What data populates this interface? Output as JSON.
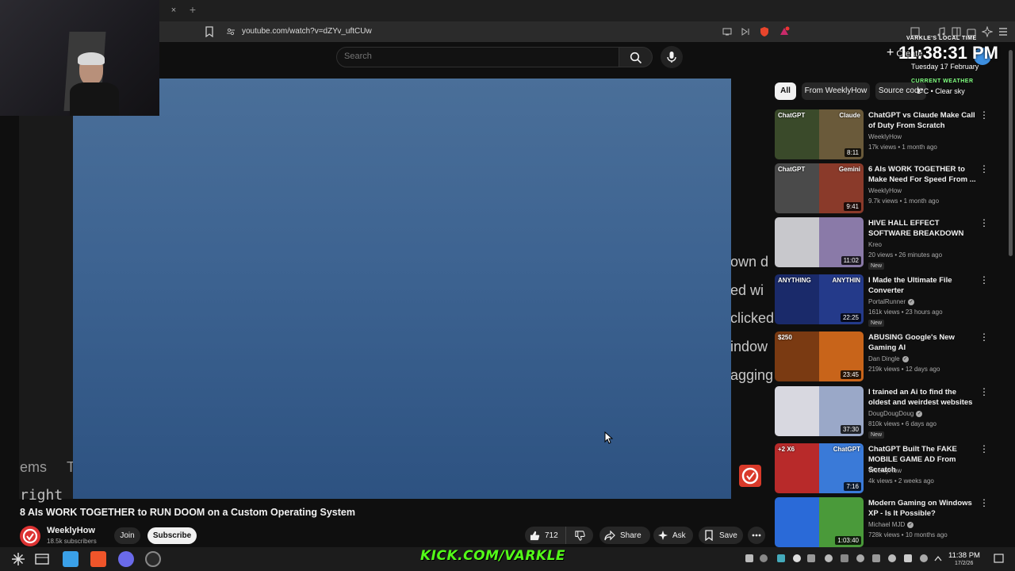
{
  "browser": {
    "url": "youtube.com/watch?v=dZYv_uftCUw",
    "tab_close": "×",
    "tab_new": "+"
  },
  "header": {
    "search_placeholder": "Search",
    "create_label": "Create"
  },
  "player": {
    "side_text": [
      "own d",
      "ed wi",
      "clicked",
      "indow",
      "agging",
      "ems",
      "T",
      "right"
    ]
  },
  "video": {
    "title": "8 AIs WORK TOGETHER to RUN DOOM on a Custom Operating System",
    "channel": "WeeklyHow",
    "subscribers": "18.5k subscribers",
    "join_label": "Join",
    "subscribe_label": "Subscribe",
    "likes": "712",
    "share_label": "Share",
    "ask_label": "Ask",
    "save_label": "Save"
  },
  "sidebar": {
    "chips": [
      "All",
      "From WeeklyHow",
      "Source code"
    ],
    "items": [
      {
        "title": "ChatGPT vs Claude Make Call of Duty From Scratch",
        "channel": "WeeklyHow",
        "verified": false,
        "meta": "17k views • 1 month ago",
        "duration": "8:11",
        "new": false,
        "thumb_colors": [
          "#3a4a2a",
          "#6a5a3a"
        ],
        "thumb_labels": [
          "ChatGPT",
          "Claude"
        ]
      },
      {
        "title": "6 AIs WORK TOGETHER to Make Need For Speed From ...",
        "channel": "WeeklyHow",
        "verified": false,
        "meta": "9.7k views • 1 month ago",
        "duration": "9:41",
        "new": false,
        "thumb_colors": [
          "#4a4a4a",
          "#8a3a2a"
        ],
        "thumb_labels": [
          "ChatGPT",
          "Gemini"
        ]
      },
      {
        "title": "HIVE HALL EFFECT SOFTWARE BREAKDOWN",
        "channel": "Kreo",
        "verified": false,
        "meta": "20 views • 26 minutes ago",
        "duration": "11:02",
        "new": true,
        "thumb_colors": [
          "#c8c8cc",
          "#8a7aa8"
        ],
        "thumb_labels": [
          "",
          ""
        ]
      },
      {
        "title": "I Made the Ultimate File Converter",
        "channel": "PortalRunner",
        "verified": true,
        "meta": "161k views • 23 hours ago",
        "duration": "22:25",
        "new": true,
        "thumb_colors": [
          "#1a2a6a",
          "#243a8a"
        ],
        "thumb_labels": [
          "ANYTHING",
          "ANYTHIN"
        ]
      },
      {
        "title": "ABUSING Google's New Gaming AI",
        "channel": "Dan Dingle",
        "verified": true,
        "meta": "219k views • 12 days ago",
        "duration": "23:45",
        "new": false,
        "thumb_colors": [
          "#7a3a12",
          "#c8641a"
        ],
        "thumb_labels": [
          "$250",
          ""
        ]
      },
      {
        "title": "I trained an Ai to find the oldest and weirdest websites",
        "channel": "DougDougDoug",
        "verified": true,
        "meta": "810k views • 6 days ago",
        "duration": "37:30",
        "new": true,
        "thumb_colors": [
          "#d8d8e0",
          "#9aa8c8"
        ],
        "thumb_labels": [
          "",
          ""
        ]
      },
      {
        "title": "ChatGPT Built The FAKE MOBILE GAME AD From Scratch",
        "channel": "WeeklyHow",
        "verified": false,
        "meta": "4k views • 2 weeks ago",
        "duration": "7:16",
        "new": false,
        "thumb_colors": [
          "#b82a2a",
          "#3a7ad8"
        ],
        "thumb_labels": [
          "+2 X6",
          "ChatGPT"
        ]
      },
      {
        "title": "Modern Gaming on Windows XP - Is It Possible?",
        "channel": "Michael MJD",
        "verified": true,
        "meta": "728k views • 10 months ago",
        "duration": "1:03:40",
        "new": false,
        "thumb_colors": [
          "#2a6ad8",
          "#4a9a3a"
        ],
        "thumb_labels": [
          "",
          ""
        ]
      }
    ],
    "new_label": "New"
  },
  "overlay": {
    "clock_label": "VARKLE'S LOCAL TIME",
    "time": "11:38:31 PM",
    "date": "Tuesday 17 February",
    "weather_label": "CURRENT WEATHER",
    "weather": "1°C • Clear sky",
    "kick": "KICK.COM/VARKLE"
  },
  "taskbar": {
    "time": "11:38 PM",
    "date": "17/2/26"
  },
  "colors": {
    "accent_red": "#ff0000",
    "kick_green": "#53fc18"
  }
}
